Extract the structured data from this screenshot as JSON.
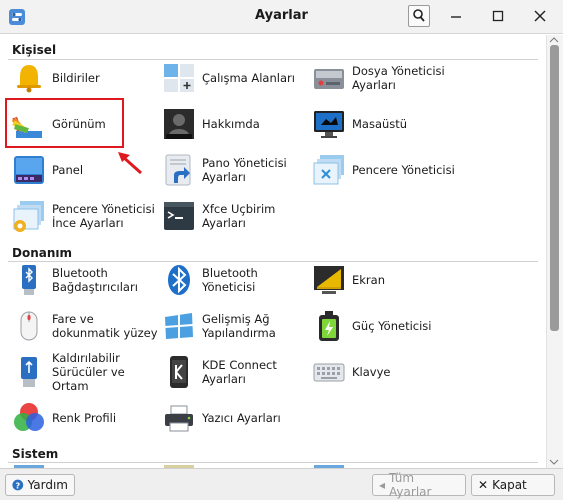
{
  "window": {
    "title": "Ayarlar"
  },
  "sections": [
    {
      "name": "Kişisel",
      "items": [
        {
          "label": "Bildiriler",
          "icon": "bell-icon"
        },
        {
          "label": "Çalışma Alanları",
          "icon": "workspaces-icon"
        },
        {
          "label": "Dosya Yöneticisi\nAyarları",
          "icon": "file-manager-icon"
        },
        {
          "label": "Görünüm",
          "icon": "appearance-palette-icon"
        },
        {
          "label": "Hakkımda",
          "icon": "about-me-icon"
        },
        {
          "label": "Masaüstü",
          "icon": "desktop-icon"
        },
        {
          "label": "Panel",
          "icon": "panel-icon"
        },
        {
          "label": "Pano Yöneticisi\nAyarları",
          "icon": "clipboard-manager-icon"
        },
        {
          "label": "Pencere Yöneticisi",
          "icon": "window-manager-icon"
        },
        {
          "label": "Pencere Yöneticisi\nİnce Ayarları",
          "icon": "window-tweaks-icon"
        },
        {
          "label": "Xfce Uçbirim\nAyarları",
          "icon": "terminal-icon"
        }
      ]
    },
    {
      "name": "Donanım",
      "items": [
        {
          "label": "Bluetooth\nBağdaştırıcıları",
          "icon": "bluetooth-adapter-icon"
        },
        {
          "label": "Bluetooth Yöneticisi",
          "icon": "bluetooth-icon"
        },
        {
          "label": "Ekran",
          "icon": "display-icon"
        },
        {
          "label": "Fare ve\ndokunmatik yüzey",
          "icon": "mouse-icon"
        },
        {
          "label": "Gelişmiş Ağ\nYapılandırma",
          "icon": "network-icon"
        },
        {
          "label": "Güç Yöneticisi",
          "icon": "battery-icon"
        },
        {
          "label": "Kaldırılabilir\nSürücüler ve Ortam",
          "icon": "usb-drive-icon"
        },
        {
          "label": "KDE Connect\nAyarları",
          "icon": "kde-connect-icon"
        },
        {
          "label": "Klavye",
          "icon": "keyboard-icon"
        },
        {
          "label": "Renk Profili",
          "icon": "color-profile-icon"
        },
        {
          "label": "Yazıcı Ayarları",
          "icon": "printer-icon"
        }
      ]
    },
    {
      "name": "Sistem",
      "items": []
    }
  ],
  "buttons": {
    "help": "Yardım",
    "all_settings": "Tüm Ayarlar",
    "close": "Kapat"
  },
  "colors": {
    "highlight": "#e0191e",
    "titlebar": "#f2f2f2"
  }
}
